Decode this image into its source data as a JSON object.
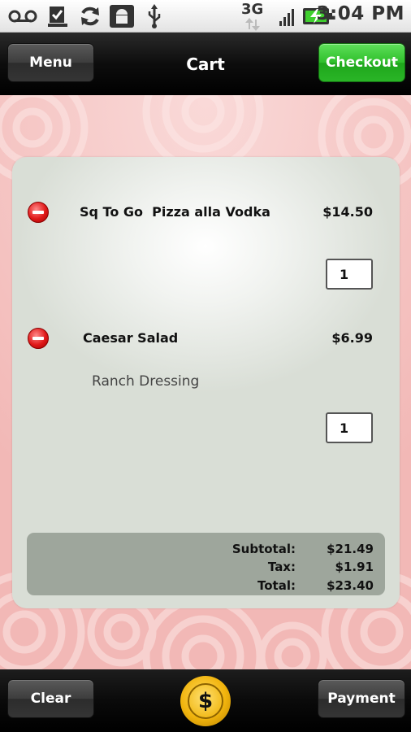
{
  "status_bar": {
    "network": "3G",
    "time": "3:04 PM",
    "icons": [
      "voicemail-icon",
      "task-icon",
      "sync-icon",
      "android-icon",
      "usb-icon",
      "signal-icon",
      "battery-charging-icon"
    ]
  },
  "header": {
    "title": "Cart",
    "menu_label": "Menu",
    "checkout_label": "Checkout"
  },
  "cart": {
    "items": [
      {
        "name": "Sq To Go  Pizza alla Vodka",
        "price": "$14.50",
        "modifier": "",
        "quantity": "1"
      },
      {
        "name": "Caesar Salad",
        "price": "$6.99",
        "modifier": "Ranch Dressing",
        "quantity": "1"
      }
    ],
    "totals": {
      "subtotal_label": "Subtotal:",
      "subtotal": "$21.49",
      "tax_label": "Tax:",
      "tax": "$1.91",
      "total_label": "Total:",
      "total": "$23.40"
    }
  },
  "footer": {
    "clear_label": "Clear",
    "payment_label": "Payment",
    "coin_symbol": "$"
  },
  "colors": {
    "checkout_green": "#2fbf2b",
    "background_pink": "#f2b8b6",
    "remove_red": "#e01818"
  }
}
